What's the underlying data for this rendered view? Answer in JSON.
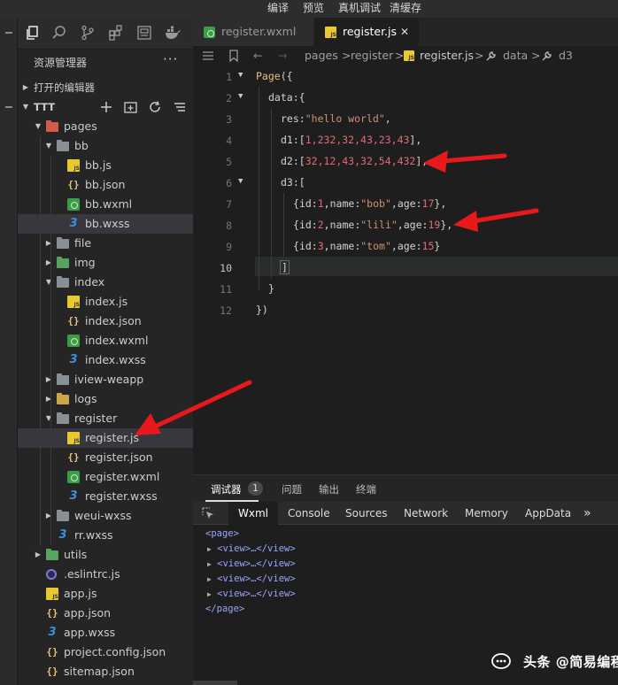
{
  "topbar": {
    "compile": "编译",
    "preview": "预览",
    "remote_debug": "真机调试",
    "clear_cache": "清缓存"
  },
  "explorer": {
    "title": "资源管理器",
    "more": "···",
    "open_editors": "打开的编辑器",
    "project": "TTT",
    "tree": [
      {
        "label": "pages",
        "icon": "folder-red",
        "level": 1,
        "arrow": "open"
      },
      {
        "label": "bb",
        "icon": "folder",
        "level": 2,
        "arrow": "open"
      },
      {
        "label": "bb.js",
        "icon": "js",
        "level": 3
      },
      {
        "label": "bb.json",
        "icon": "json",
        "level": 3
      },
      {
        "label": "bb.wxml",
        "icon": "wxml",
        "level": 3
      },
      {
        "label": "bb.wxss",
        "icon": "wxss",
        "level": 3,
        "selected": true
      },
      {
        "label": "file",
        "icon": "folder",
        "level": 2,
        "arrow": "closed"
      },
      {
        "label": "img",
        "icon": "folder-green",
        "level": 2,
        "arrow": "closed"
      },
      {
        "label": "index",
        "icon": "folder",
        "level": 2,
        "arrow": "open"
      },
      {
        "label": "index.js",
        "icon": "js",
        "level": 3
      },
      {
        "label": "index.json",
        "icon": "json",
        "level": 3
      },
      {
        "label": "index.wxml",
        "icon": "wxml",
        "level": 3
      },
      {
        "label": "index.wxss",
        "icon": "wxss",
        "level": 3
      },
      {
        "label": "iview-weapp",
        "icon": "folder",
        "level": 2,
        "arrow": "closed"
      },
      {
        "label": "logs",
        "icon": "folder-yellow",
        "level": 2,
        "arrow": "closed"
      },
      {
        "label": "register",
        "icon": "folder",
        "level": 2,
        "arrow": "open"
      },
      {
        "label": "register.js",
        "icon": "js",
        "level": 3,
        "selected": true
      },
      {
        "label": "register.json",
        "icon": "json",
        "level": 3
      },
      {
        "label": "register.wxml",
        "icon": "wxml",
        "level": 3
      },
      {
        "label": "register.wxss",
        "icon": "wxss",
        "level": 3
      },
      {
        "label": "weui-wxss",
        "icon": "folder",
        "level": 2,
        "arrow": "closed"
      },
      {
        "label": "rr.wxss",
        "icon": "wxss",
        "level": 2
      },
      {
        "label": "utils",
        "icon": "folder-green",
        "level": 1,
        "arrow": "closed"
      },
      {
        "label": ".eslintrc.js",
        "icon": "eslint",
        "level": 1
      },
      {
        "label": "app.js",
        "icon": "js",
        "level": 1
      },
      {
        "label": "app.json",
        "icon": "json",
        "level": 1
      },
      {
        "label": "app.wxss",
        "icon": "wxss",
        "level": 1
      },
      {
        "label": "project.config.json",
        "icon": "json",
        "level": 1
      },
      {
        "label": "sitemap.json",
        "icon": "json",
        "level": 1
      }
    ]
  },
  "tabs": [
    {
      "label": "register.wxml",
      "icon": "wxml",
      "active": false
    },
    {
      "label": "register.js",
      "icon": "js",
      "active": true,
      "close": "✕"
    }
  ],
  "breadcrumb": {
    "parts": [
      "pages",
      "register",
      "register.js",
      "data",
      "d3"
    ],
    "separator": ">"
  },
  "editor": {
    "current_line": 10,
    "lines": [
      {
        "n": "1"
      },
      {
        "n": "2"
      },
      {
        "n": "3"
      },
      {
        "n": "4"
      },
      {
        "n": "5"
      },
      {
        "n": "6"
      },
      {
        "n": "7"
      },
      {
        "n": "8"
      },
      {
        "n": "9"
      },
      {
        "n": "10"
      },
      {
        "n": "11"
      },
      {
        "n": "12"
      }
    ],
    "code": {
      "l1_page": "Page",
      "l1_open": "({",
      "l2_key": "data",
      "l2_rest": ":{",
      "l3_key": "res",
      "l3_colon": ":",
      "l3_val": "\"hello world\"",
      "l3_end": ",",
      "l4_key": "d1",
      "l4_open": ":[",
      "l4_nums": "1,232,32,43,23,43",
      "l4_end": "],",
      "l5_key": "d2",
      "l5_open": ":[",
      "l5_nums": "32,12,43,32,54,432",
      "l5_end": "],",
      "l6_key": "d3",
      "l6_open": ":[",
      "l7": {
        "pre": "{",
        "k1": "id",
        "v1": "1",
        "k2": "name",
        "v2": "\"bob\"",
        "k3": "age",
        "v3": "17",
        "post": "},"
      },
      "l8": {
        "pre": "{",
        "k1": "id",
        "v1": "2",
        "k2": "name",
        "v2": "\"lili\"",
        "k3": "age",
        "v3": "19",
        "post": "},"
      },
      "l9": {
        "pre": "{",
        "k1": "id",
        "v1": "3",
        "k2": "name",
        "v2": "\"tom\"",
        "k3": "age",
        "v3": "15",
        "post": "}"
      },
      "l10": "]",
      "l11": "}",
      "l12": "})"
    }
  },
  "panel": {
    "tabs": [
      "调试器",
      "问题",
      "输出",
      "终端"
    ],
    "badge": "1",
    "devtools_tabs": [
      "Wxml",
      "Console",
      "Sources",
      "Network",
      "Memory",
      "AppData"
    ],
    "more": "»",
    "wxml_tree": {
      "root_open": "<page>",
      "children": [
        "<view>…</view>",
        "<view>…</view>",
        "<view>…</view>",
        "<view>…</view>"
      ],
      "root_close": "</page>"
    }
  },
  "watermark": {
    "text": "头条 @简易编程网"
  },
  "colors": {
    "arrow": "#e8191b",
    "keyword": "#e5c07b",
    "string": "#ce9178",
    "number": "#e06c75"
  }
}
